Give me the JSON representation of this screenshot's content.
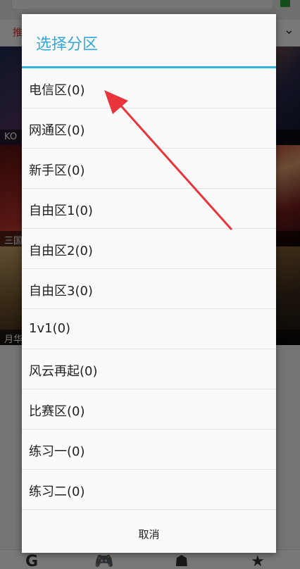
{
  "background": {
    "tab_first": "推",
    "poster1_caption": "KO",
    "poster2_caption": "三国",
    "poster3_caption": "月华"
  },
  "dialog": {
    "title": "选择分区",
    "items": [
      {
        "label": "电信区(0)"
      },
      {
        "label": "网通区(0)"
      },
      {
        "label": "新手区(0)"
      },
      {
        "label": "自由区1(0)"
      },
      {
        "label": "自由区2(0)"
      },
      {
        "label": "自由区3(0)"
      },
      {
        "label": "1v1(0)"
      },
      {
        "label": "风云再起(0)"
      },
      {
        "label": "比赛区(0)"
      },
      {
        "label": "练习一(0)"
      },
      {
        "label": "练习二(0)"
      }
    ],
    "cancel_label": "取消"
  },
  "colors": {
    "title": "#33a8d8",
    "divider": "#35b1e0",
    "arrow": "#e8343a"
  }
}
